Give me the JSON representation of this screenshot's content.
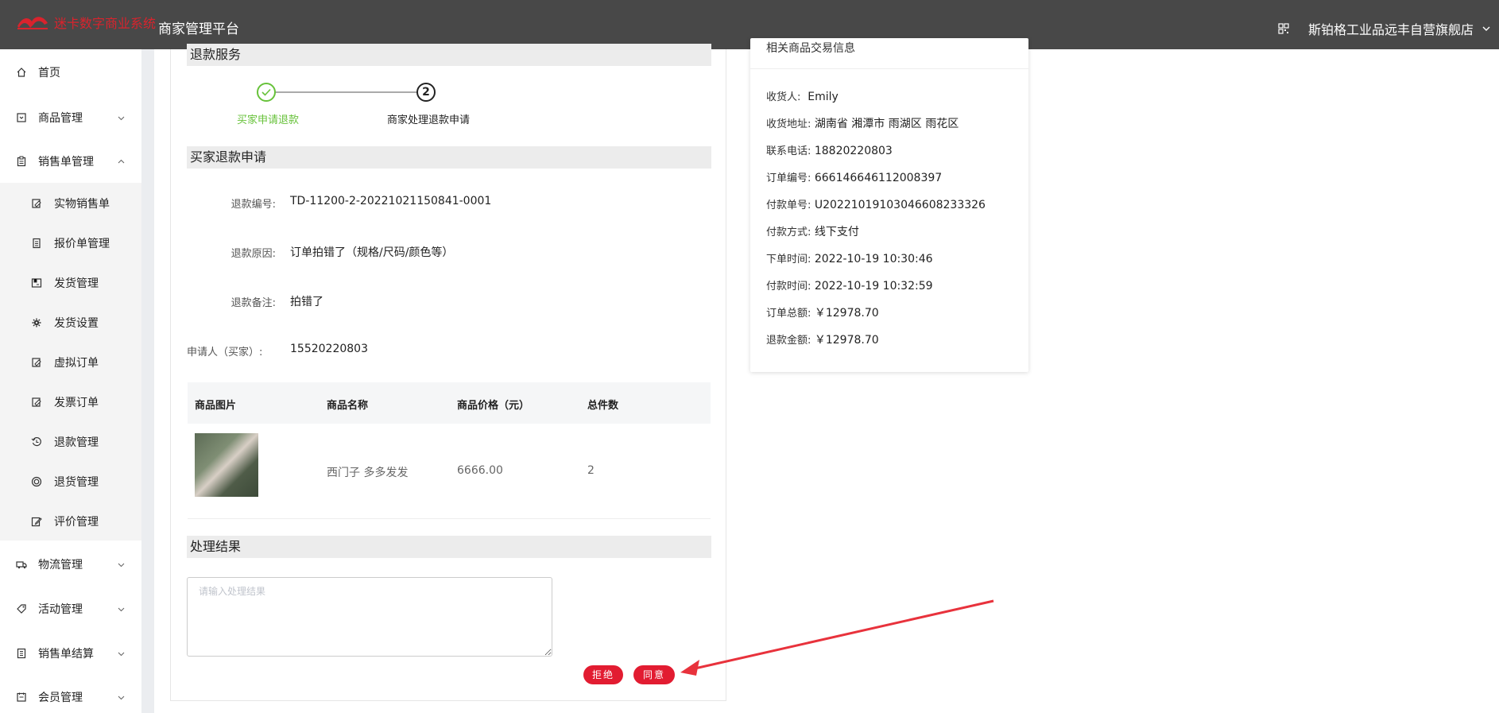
{
  "header": {
    "logo_text": "迷卡数字商业系统",
    "platform_title": "商家管理平台",
    "store_name": "斯铂格工业品远丰自营旗舰店",
    "icons": [
      "qr-code-icon",
      "chevron-down-icon"
    ]
  },
  "sidebar": {
    "items": [
      {
        "label": "首页",
        "icon": "home-icon"
      },
      {
        "label": "商品管理",
        "icon": "goods-icon"
      },
      {
        "label": "销售单管理",
        "icon": "clipboard-icon"
      },
      {
        "label": "物流管理",
        "icon": "truck-icon"
      },
      {
        "label": "活动管理",
        "icon": "tag-icon"
      },
      {
        "label": "销售单结算",
        "icon": "ledger-icon"
      },
      {
        "label": "会员管理",
        "icon": "member-icon"
      }
    ],
    "subitems": [
      {
        "label": "实物销售单",
        "icon": "edit-doc-icon"
      },
      {
        "label": "报价单管理",
        "icon": "doc-icon"
      },
      {
        "label": "发货管理",
        "icon": "ship-icon"
      },
      {
        "label": "发货设置",
        "icon": "gear-icon"
      },
      {
        "label": "虚拟订单",
        "icon": "edit-doc-icon"
      },
      {
        "label": "发票订单",
        "icon": "edit-doc-icon"
      },
      {
        "label": "退款管理",
        "icon": "refund-icon"
      },
      {
        "label": "退货管理",
        "icon": "return-icon"
      },
      {
        "label": "评价管理",
        "icon": "pen-icon"
      }
    ]
  },
  "refund": {
    "section_title": "退款服务",
    "steps": [
      {
        "label": "买家申请退款",
        "status": "done"
      },
      {
        "label": "商家处理退款申请",
        "number": "2",
        "status": "current"
      }
    ],
    "apply_title": "买家退款申请",
    "fields": [
      {
        "label": "退款编号:",
        "value": "TD-11200-2-20221021150841-0001"
      },
      {
        "label": "退款原因:",
        "value": "订单拍错了（规格/尺码/颜色等）"
      },
      {
        "label": "退款备注:",
        "value": "拍错了"
      },
      {
        "label": "申请人（买家）:",
        "value": "15520220803"
      }
    ],
    "table": {
      "headers": [
        "商品图片",
        "商品名称",
        "商品价格（元）",
        "总件数"
      ],
      "rows": [
        {
          "name": "西门子 多多发发",
          "price": "6666.00",
          "qty": "2"
        }
      ]
    },
    "result_title": "处理结果",
    "result_placeholder": "请输入处理结果",
    "reject_label": "拒绝",
    "agree_label": "同意"
  },
  "order_info": {
    "title": "相关商品交易信息",
    "rows": [
      {
        "label": "收货人:",
        "value": "Emily"
      },
      {
        "label": "收货地址:",
        "value": "湖南省 湘潭市 雨湖区 雨花区"
      },
      {
        "label": "联系电话:",
        "value": "18820220803"
      },
      {
        "label": "订单编号:",
        "value": "666146646112008397"
      },
      {
        "label": "付款单号:",
        "value": "U20221019103046608233326"
      },
      {
        "label": "付款方式:",
        "value": "线下支付"
      },
      {
        "label": "下单时间:",
        "value": "2022-10-19 10:30:46"
      },
      {
        "label": "付款时间:",
        "value": "2022-10-19 10:32:59"
      },
      {
        "label": "订单总额:",
        "value": "￥12978.70"
      },
      {
        "label": "退款金额:",
        "value": "￥12978.70"
      }
    ]
  },
  "colors": {
    "header_bg": "#484848",
    "brand_red": "#e21c31",
    "step_done": "#67c23a",
    "annotation_arrow": "#e8323c"
  }
}
